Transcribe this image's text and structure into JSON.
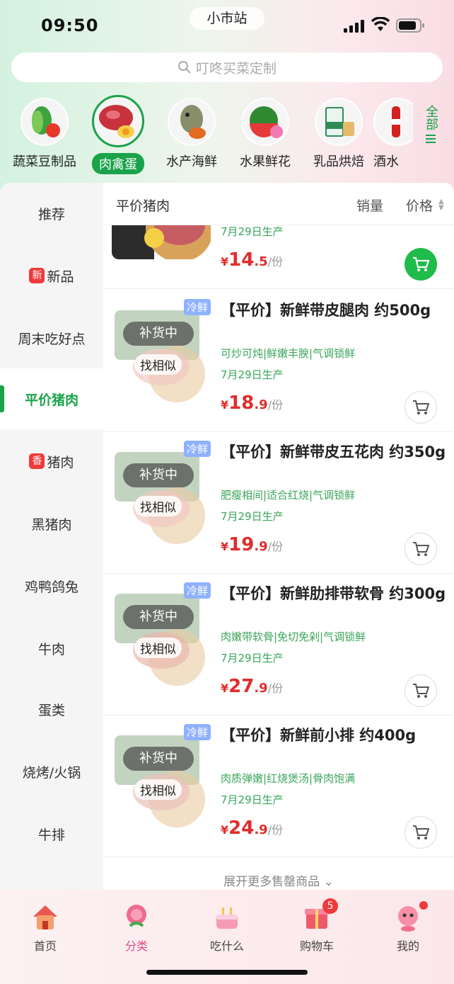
{
  "status": {
    "time": "09:50",
    "station": "小市站"
  },
  "search": {
    "placeholder": "叮咚买菜定制"
  },
  "categories": [
    {
      "label": "蔬菜豆制品",
      "icon": "vegetables-icon"
    },
    {
      "label": "肉禽蛋",
      "icon": "meat-icon",
      "active": true
    },
    {
      "label": "水产海鲜",
      "icon": "seafood-icon"
    },
    {
      "label": "水果鲜花",
      "icon": "watermelon-icon"
    },
    {
      "label": "乳品烘焙",
      "icon": "milk-icon"
    },
    {
      "label": "酒水",
      "icon": "drink-icon"
    }
  ],
  "all_categories": "全部",
  "sidebar": {
    "items": [
      {
        "label": "推荐"
      },
      {
        "label": "新品",
        "badge": "新"
      },
      {
        "label": "周末吃好点"
      },
      {
        "label": "平价猪肉",
        "active": true
      },
      {
        "label": "猪肉",
        "badge": "香"
      },
      {
        "label": "黑猪肉"
      },
      {
        "label": "鸡鸭鸽兔"
      },
      {
        "label": "牛肉"
      },
      {
        "label": "蛋类"
      },
      {
        "label": "烧烤/火锅"
      },
      {
        "label": "牛排"
      }
    ]
  },
  "list": {
    "title": "平价猪肉",
    "sort_sales": "销量",
    "sort_price": "价格",
    "first_partial": {
      "date": "7月29日生产",
      "price_int": "14",
      "price_dec": ".5",
      "unit": "/份"
    },
    "products": [
      {
        "badge": "冷鲜",
        "status": "补货中",
        "similar": "找相似",
        "title": "【平价】新鲜带皮腿肉 约500g",
        "tags": "可炒可炖|鲜嫩丰腴|气调锁鲜",
        "date": "7月29日生产",
        "price_int": "18",
        "price_dec": ".9",
        "unit": "/份"
      },
      {
        "badge": "冷鲜",
        "status": "补货中",
        "similar": "找相似",
        "title": "【平价】新鲜带皮五花肉 约350g",
        "tags": "肥瘦相间|适合红烧|气调锁鲜",
        "date": "7月29日生产",
        "price_int": "19",
        "price_dec": ".9",
        "unit": "/份"
      },
      {
        "badge": "冷鲜",
        "status": "补货中",
        "similar": "找相似",
        "title": "【平价】新鲜肋排带软骨 约300g",
        "tags": "肉嫩带软骨|免切免剁|气调锁鲜",
        "date": "7月29日生产",
        "price_int": "27",
        "price_dec": ".9",
        "unit": "/份"
      },
      {
        "badge": "冷鲜",
        "status": "补货中",
        "similar": "找相似",
        "title": "【平价】新鲜前小排 约400g",
        "tags": "肉质弹嫩|红烧煲汤|骨肉饱满",
        "date": "7月29日生产",
        "price_int": "24",
        "price_dec": ".9",
        "unit": "/份"
      }
    ],
    "more": "展开更多售罄商品"
  },
  "bottom_nav": [
    {
      "label": "首页",
      "icon": "home-icon"
    },
    {
      "label": "分类",
      "icon": "category-icon",
      "active": true
    },
    {
      "label": "吃什么",
      "icon": "cake-icon"
    },
    {
      "label": "购物车",
      "icon": "cart-icon",
      "count": "5"
    },
    {
      "label": "我的",
      "icon": "profile-icon"
    }
  ],
  "colors": {
    "accent": "#1aa34a",
    "price": "#e22c2c",
    "tag": "#3aa55b",
    "active_nav": "#e04a86"
  }
}
